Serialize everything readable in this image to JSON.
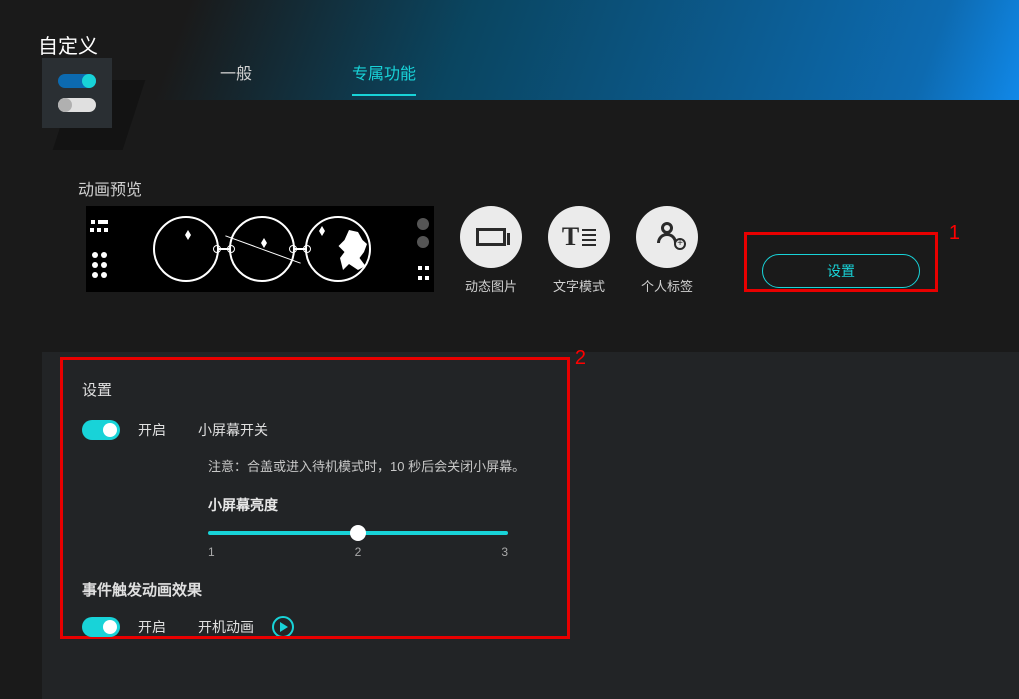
{
  "page_title": "自定义",
  "tabs": {
    "general": "一般",
    "exclusive": "专属功能"
  },
  "preview_label": "动画预览",
  "modes": {
    "dynamic_image": "动态图片",
    "text_mode": "文字模式",
    "personal_tag": "个人标签"
  },
  "settings_button": "设置",
  "annotations": {
    "one": "1",
    "two": "2"
  },
  "panel": {
    "title": "设置",
    "on_label": "开启",
    "screen_switch_label": "小屏幕开关",
    "note": "注意：合盖或进入待机模式时，10 秒后会关闭小屏幕。",
    "brightness_label": "小屏幕亮度",
    "brightness_ticks": {
      "t1": "1",
      "t2": "2",
      "t3": "3"
    },
    "event_section": "事件触发动画效果",
    "boot_anim_label": "开机动画"
  }
}
